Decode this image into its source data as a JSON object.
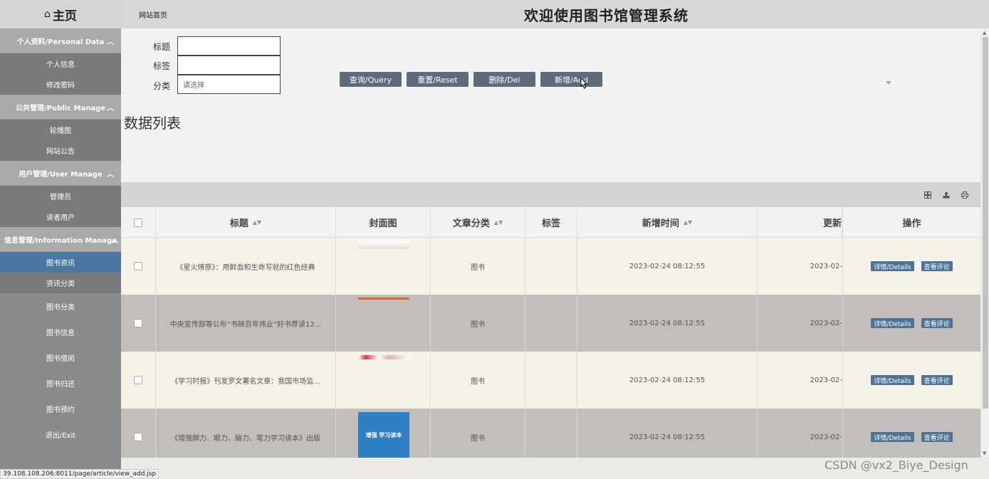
{
  "sidebar": {
    "home_icon": "home-icon",
    "home": "主页",
    "sections": [
      {
        "title": "个人资料/Personal Data",
        "items": [
          "个人信息",
          "修改密码"
        ]
      },
      {
        "title": "公共管理/Public Manage",
        "items": [
          "轮播图",
          "网站公告"
        ]
      },
      {
        "title": "用户管理/User Manage",
        "items": [
          "管理员",
          "读者用户"
        ]
      },
      {
        "title": "信息管理/Information Manage",
        "items": [
          "图书资讯",
          "资讯分类"
        ]
      }
    ],
    "plain_items": [
      "图书分类",
      "图书信息",
      "图书借阅",
      "图书归还",
      "图书预约",
      "退出/Exit"
    ],
    "active_item": "图书资讯",
    "active_color": "#4a78a2"
  },
  "header": {
    "site_link": "网站首页",
    "title": "欢迎使用图书馆管理系统"
  },
  "search": {
    "title_label": "标题",
    "tag_label": "标签",
    "category_label": "分类",
    "category_placeholder": "请选择",
    "buttons": {
      "query": "查询/Query",
      "reset": "重置/Reset",
      "delete": "删除/Del",
      "add": "新增/Add"
    }
  },
  "list_title": "数据列表",
  "toolbar_icons": [
    "grid-icon",
    "export-icon",
    "print-icon"
  ],
  "table": {
    "columns": {
      "title": "标题",
      "cover": "封面图",
      "category": "文章分类",
      "tag": "标签",
      "created": "新增时间",
      "updated": "更新",
      "actions": "操作"
    },
    "rows": [
      {
        "title": "《星火燎原》：用鲜血和生命写就的红色经典",
        "category": "图书",
        "tag": "",
        "created": "2023-02-24 08:12:55",
        "updated": "2023-02-"
      },
      {
        "title": "中央宣传部等公布“书映百年伟业”好书荐读12...",
        "category": "图书",
        "tag": "",
        "created": "2023-02-24 08:12:55",
        "updated": "2023-02-"
      },
      {
        "title": "《学习时报》刊发罗文署名文章：我国市场监...",
        "category": "图书",
        "tag": "",
        "created": "2023-02-24 08:12:55",
        "updated": "2023-02-"
      },
      {
        "title": "《增强脚力、眼力、脑力、笔力学习读本》出版",
        "category": "图书",
        "tag": "",
        "created": "2023-02-24 08:12:55",
        "updated": "2023-02-"
      }
    ],
    "action_details": "详情/Details",
    "action_comments": "查看评论",
    "book_cover_text": "增强 学习读本"
  },
  "status_url": "39.108.108.206:8011/page/article/view_add.jsp",
  "watermark": "CSDN @vx2_Biye_Design"
}
